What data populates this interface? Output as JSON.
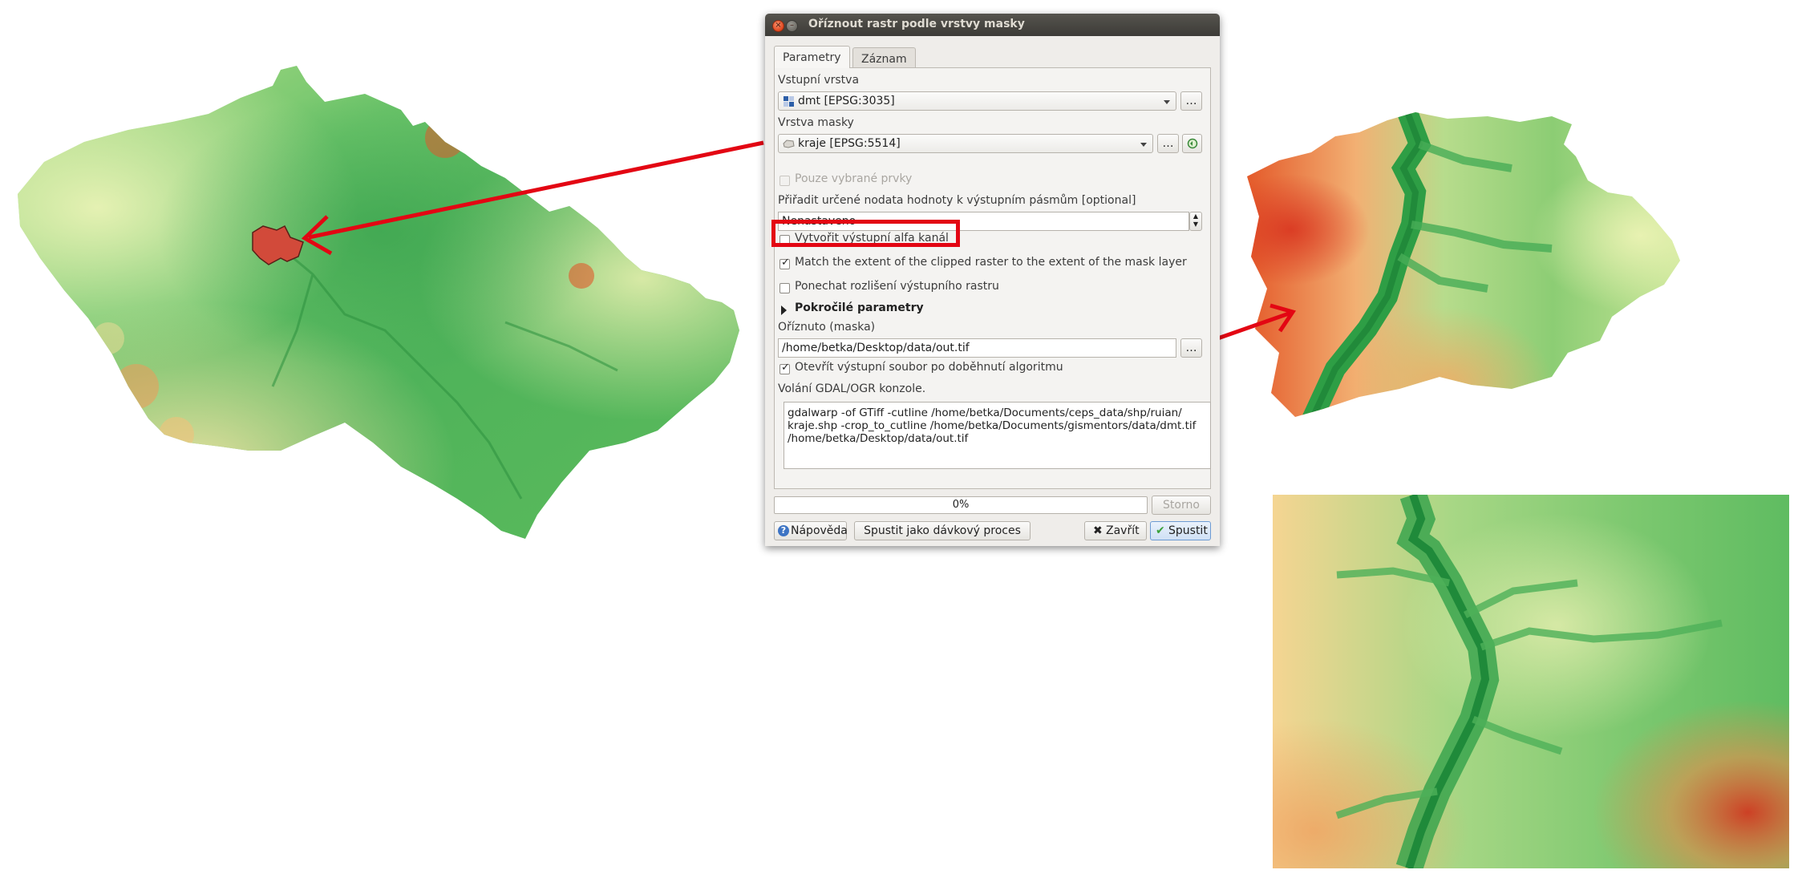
{
  "dialog": {
    "title": "Oříznout rastr podle vrstvy masky",
    "tabs": [
      "Parametry",
      "Záznam"
    ],
    "input_layer": {
      "label": "Vstupní vrstva",
      "value": "dmt [EPSG:3035]"
    },
    "mask_layer": {
      "label": "Vrstva masky",
      "value": "kraje [EPSG:5514]"
    },
    "selected_only": {
      "label": "Pouze vybrané prvky",
      "checked": false,
      "enabled": false
    },
    "nodata": {
      "label": "Přiřadit určené nodata hodnoty k výstupním pásmům [optional]",
      "value": "Nenastaveno"
    },
    "alpha": {
      "label": "Vytvořit výstupní alfa kanál",
      "checked": false
    },
    "match_extent": {
      "label": "Match the extent of the clipped raster to the extent of the mask layer",
      "checked": true
    },
    "keep_resolution": {
      "label": "Ponechat rozlišení výstupního rastru",
      "checked": false
    },
    "advanced": {
      "label": "Pokročilé parametry"
    },
    "output": {
      "label": "Oříznuto (maska)",
      "value": "/home/betka/Desktop/data/out.tif"
    },
    "open_output": {
      "label": "Otevřít výstupní soubor po doběhnutí algoritmu",
      "checked": true
    },
    "console": {
      "label": "Volání GDAL/OGR konzole.",
      "lines": [
        "gdalwarp -of GTiff -cutline /home/betka/Documents/ceps_data/shp/ruian/",
        "kraje.shp -crop_to_cutline /home/betka/Documents/gismentors/data/dmt.tif",
        "/home/betka/Desktop/data/out.tif"
      ]
    },
    "progress": {
      "text": "0%",
      "value": 0
    },
    "buttons": {
      "browse": "…",
      "cancel": "Storno",
      "help": "Nápověda",
      "batch": "Spustit jako dávkový proces",
      "close": "Zavřít",
      "run": "Spustit"
    }
  },
  "colors": {
    "annotation_red": "#e30613",
    "highlight_region": "#d24a3a",
    "elevation_low": "#2e9e45",
    "elevation_mid": "#c8e39a",
    "elevation_high": "#d8321e"
  },
  "icons": [
    "raster-layer-icon",
    "vector-layer-icon",
    "iterate-icon",
    "help-icon",
    "close-icon",
    "check-icon",
    "expand-arrow-icon"
  ]
}
